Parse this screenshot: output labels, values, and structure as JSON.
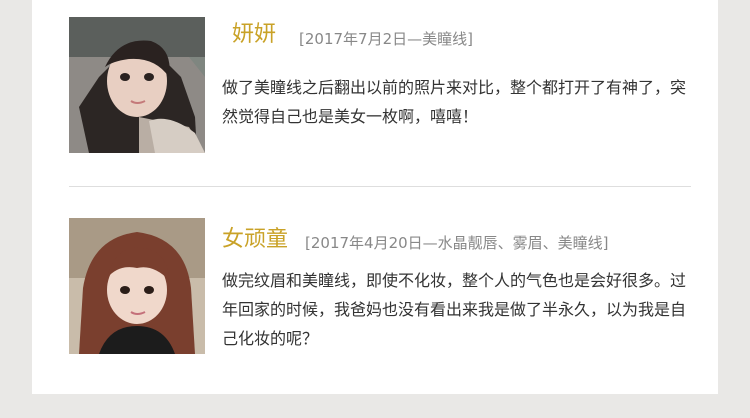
{
  "reviews": [
    {
      "name": "妍妍",
      "meta": "[2017年7月2日—美瞳线]",
      "text": "做了美瞳线之后翻出以前的照片来对比，整个都打开了有神了，突然觉得自己也是美女一枚啊，嘻嘻！"
    },
    {
      "name": "女顽童",
      "meta": "[2017年4月20日—水晶靓唇、雾眉、美瞳线]",
      "text": "做完纹眉和美瞳线，即使不化妆，整个人的气色也是会好很多。过年回家的时候，我爸妈也没有看出来我是做了半永久，以为我是自己化妆的呢？"
    }
  ],
  "colors": {
    "name": "#c9a227",
    "meta": "#888888",
    "body": "#333333",
    "background": "#e9e8e6",
    "card": "#ffffff"
  }
}
